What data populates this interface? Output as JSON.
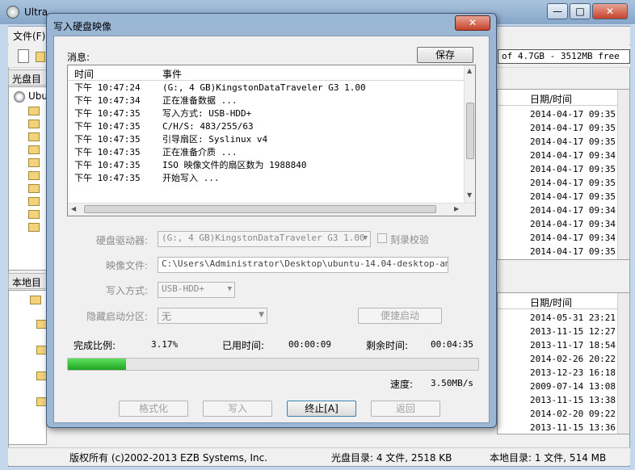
{
  "app": {
    "title": "Ultra",
    "menu_file": "文件(F)",
    "size_box": "of 4.7GB - 3512MB free",
    "cd_pane_header": "光盘目",
    "local_pane_header": "本地目",
    "tree_root": "Ubu",
    "date_header_top": "日期/时间",
    "date_header_bottom": "日期/时间",
    "dates_top": [
      "2014-04-17 09:35",
      "2014-04-17 09:35",
      "2014-04-17 09:35",
      "2014-04-17 09:34",
      "2014-04-17 09:35",
      "2014-04-17 09:35",
      "2014-04-17 09:35",
      "2014-04-17 09:34",
      "2014-04-17 09:34",
      "2014-04-17 09:34",
      "2014-04-17 09:35"
    ],
    "dates_bottom": [
      "2014-05-31 23:21",
      "2013-11-15 12:27",
      "2013-11-17 18:54",
      "2014-02-26 20:22",
      "2013-12-23 16:18",
      "2009-07-14 13:08",
      "2013-11-15 13:38",
      "2014-02-20 09:22",
      "2013-11-15 13:36"
    ],
    "status_copyright": "版权所有 (c)2002-2013 EZB Systems, Inc.",
    "status_cd": "光盘目录: 4 文件, 2518 KB",
    "status_local": "本地目录: 1 文件, 514 MB",
    "window_buttons": {
      "minimize": "—",
      "maximize": "□",
      "close": "✕"
    }
  },
  "dialog": {
    "title": "写入硬盘映像",
    "close_label": "✕",
    "messages_label": "消息:",
    "save_button": "保存",
    "columns": {
      "time": "时间",
      "event": "事件"
    },
    "log": [
      {
        "time": "下午 10:47:24",
        "event": "(G:, 4 GB)KingstonDataTraveler G3 1.00"
      },
      {
        "time": "下午 10:47:34",
        "event": "正在准备数据 ..."
      },
      {
        "time": "下午 10:47:35",
        "event": "写入方式: USB-HDD+"
      },
      {
        "time": "下午 10:47:35",
        "event": "C/H/S: 483/255/63"
      },
      {
        "time": "下午 10:47:35",
        "event": "引导扇区: Syslinux v4"
      },
      {
        "time": "下午 10:47:35",
        "event": "正在准备介质 ..."
      },
      {
        "time": "下午 10:47:35",
        "event": "ISO 映像文件的扇区数为 1988840"
      },
      {
        "time": "下午 10:47:35",
        "event": "开始写入 ..."
      }
    ],
    "drive_label": "硬盘驱动器:",
    "drive_value": "(G:, 4 GB)KingstonDataTraveler G3 1.00",
    "verify_label": "刻录校验",
    "image_label": "映像文件:",
    "image_value": "C:\\Users\\Administrator\\Desktop\\ubuntu-14.04-desktop-amd64.i",
    "write_method_label": "写入方式:",
    "write_method_value": "USB-HDD+",
    "hidden_partition_label": "隐藏启动分区:",
    "hidden_partition_value": "无",
    "quick_boot_button": "便捷启动",
    "progress_label": "完成比例:",
    "progress_value": "3.17%",
    "progress_fraction": 0.0317,
    "elapsed_label": "已用时间:",
    "elapsed_value": "00:00:09",
    "remaining_label": "剩余时间:",
    "remaining_value": "00:04:35",
    "speed_label": "速度:",
    "speed_value": "3.50MB/s",
    "buttons": {
      "format": "格式化",
      "write": "写入",
      "abort": "终止[A]",
      "back": "返回"
    }
  }
}
